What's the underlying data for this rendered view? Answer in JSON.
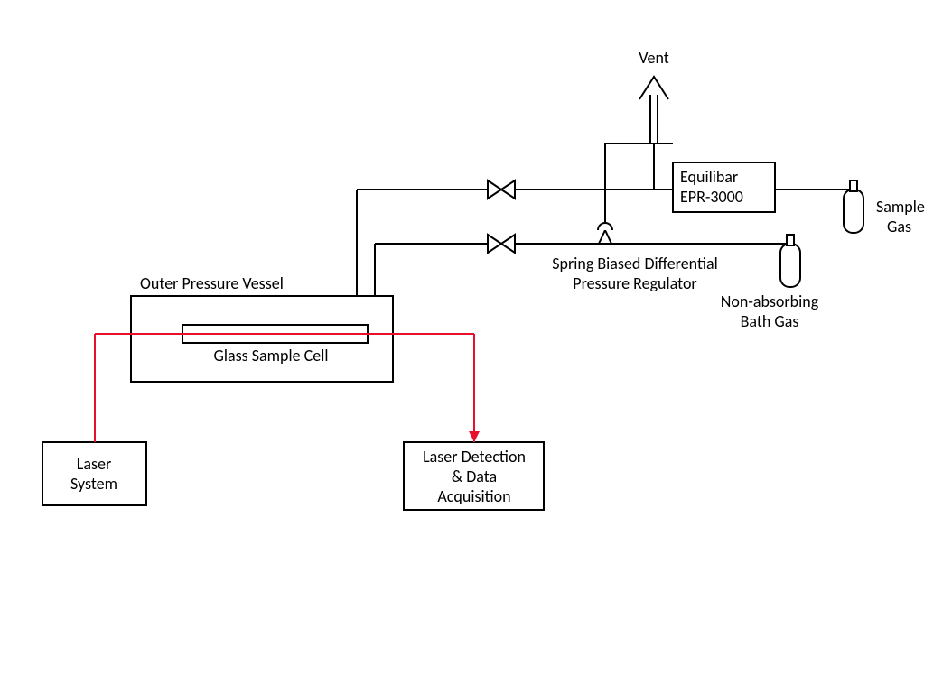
{
  "labels": {
    "vent": "Vent",
    "equilibar_line1": "Equilibar",
    "equilibar_line2": "EPR-3000",
    "sample_gas_line1": "Sample",
    "sample_gas_line2": "Gas",
    "bath_gas_line1": "Non-absorbing",
    "bath_gas_line2": "Bath Gas",
    "spring_reg_line1": "Spring Biased Differential",
    "spring_reg_line2": "Pressure Regulator",
    "outer_vessel": "Outer Pressure Vessel",
    "glass_cell": "Glass Sample Cell",
    "laser_line1": "Laser",
    "laser_line2": "System",
    "detection_line1": "Laser Detection",
    "detection_line2": "& Data",
    "detection_line3": "Acquisition"
  }
}
